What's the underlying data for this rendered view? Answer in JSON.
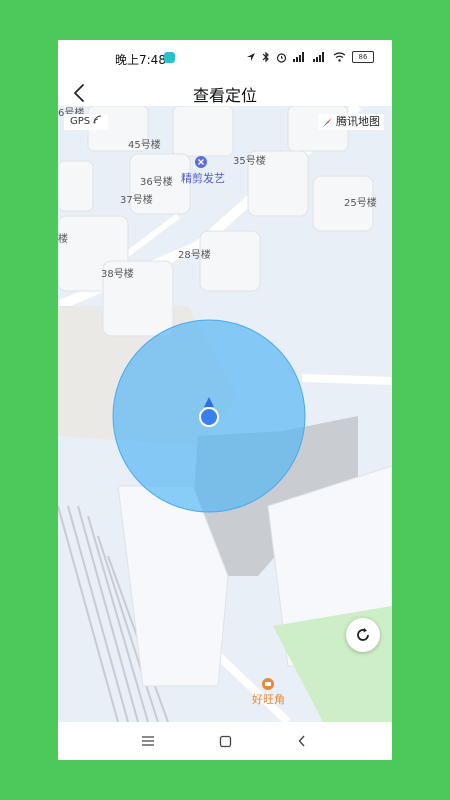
{
  "status": {
    "time": "晚上7:48",
    "battery": "86"
  },
  "header": {
    "title": "查看定位"
  },
  "map": {
    "gps_label": "GPS",
    "provider": "腾讯地图",
    "labels": [
      "6号楼",
      "45号楼",
      "35号楼",
      "36号楼",
      "37号楼",
      "25号楼",
      "28号楼",
      "38号楼",
      "楼"
    ],
    "poi_salon": "精剪发艺",
    "poi_shop": "好旺角"
  },
  "colors": {
    "accent_circle": "#4fb3f6",
    "marker": "#3a7ff0",
    "background": "#4cc95a"
  }
}
